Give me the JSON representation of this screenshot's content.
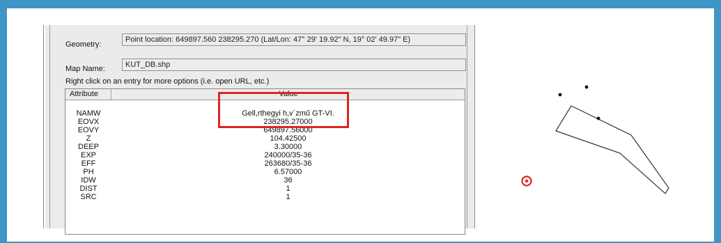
{
  "dialog": {
    "geometry_label": "Geometry:",
    "geometry_value": "Point location: 649897.560 238295.270 (Lat/Lon: 47° 29' 19.92\" N, 19° 02' 49.97\" E)",
    "map_name_label": "Map Name:",
    "map_name_value": "KUT_DB.shp",
    "hint": "Right click on an entry for more options (i.e. open URL, etc.)"
  },
  "table": {
    "headers": {
      "attribute": "Attribute",
      "value": "Value"
    },
    "rows": [
      {
        "attr": "NAMW",
        "value": "Gell,rthegyi h,v´zmű GT-VI."
      },
      {
        "attr": "EOVX",
        "value": "238295.27000"
      },
      {
        "attr": "EOVY",
        "value": "649897.56000"
      },
      {
        "attr": "Z",
        "value": "104.42500"
      },
      {
        "attr": "DEEP",
        "value": "3.30000"
      },
      {
        "attr": "EXP",
        "value": "240000/35-36"
      },
      {
        "attr": "EFF",
        "value": "263680/35-36"
      },
      {
        "attr": "PH",
        "value": "6.57000"
      },
      {
        "attr": "IDW",
        "value": "36"
      },
      {
        "attr": "DIST",
        "value": "1"
      },
      {
        "attr": "SRC",
        "value": "1"
      }
    ]
  },
  "colors": {
    "frame": "#3f95c5",
    "highlight": "#e02323",
    "selected_point": "#e02323"
  },
  "map": {
    "icons": [
      "selected-point-icon"
    ]
  }
}
